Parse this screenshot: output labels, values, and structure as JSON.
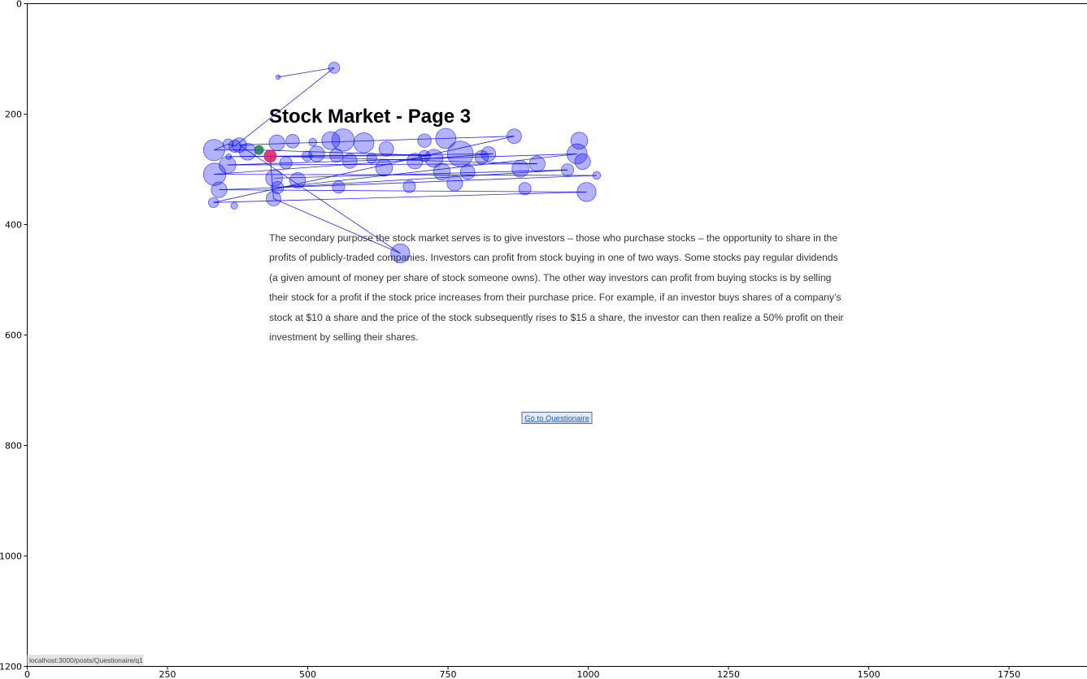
{
  "chart_data": {
    "type": "scatter",
    "title": "",
    "xlabel": "",
    "ylabel": "",
    "xlim": [
      0,
      1920
    ],
    "ylim": [
      1200,
      0
    ],
    "x_ticks": [
      0,
      250,
      500,
      750,
      1000,
      1250,
      1500,
      1750
    ],
    "y_ticks": [
      0,
      200,
      400,
      600,
      800,
      1000,
      1200
    ],
    "grid": false,
    "background_page": {
      "heading": "Stock Market - Page 3",
      "paragraph_lines": [
        "The secondary purpose the stock market serves is to give investors – those who purchase stocks – the opportunity to share in the",
        "profits of publicly-traded companies. Investors can profit from stock buying in one of two ways. Some stocks pay regular dividends",
        "(a given amount of money per share of stock someone owns). The other way investors can profit from buying stocks is by selling",
        "their stock for a profit if the stock price increases from their purchase price. For example, if an investor buys shares of a company’s",
        "stock at $10 a share and the price of the stock subsequently rises to $15 a share, the investor can then realize a 50% profit on their",
        "investment by selling their shares."
      ],
      "button_label": "Go to Questionaire",
      "status_url": "localhost:3000/posts/Questionaire/q1"
    },
    "series": [
      {
        "style": "fixations",
        "color": "#0000ff",
        "points": [
          {
            "x": 447,
            "y": 133,
            "d": 8
          },
          {
            "x": 547,
            "y": 116,
            "d": 20
          },
          {
            "x": 370,
            "y": 258,
            "d": 22
          },
          {
            "x": 358,
            "y": 254,
            "d": 18
          },
          {
            "x": 333,
            "y": 265,
            "d": 38
          },
          {
            "x": 393,
            "y": 268,
            "d": 30
          },
          {
            "x": 378,
            "y": 256,
            "d": 26
          },
          {
            "x": 359,
            "y": 277,
            "d": 10
          },
          {
            "x": 357,
            "y": 292,
            "d": 30
          },
          {
            "x": 334,
            "y": 309,
            "d": 40
          },
          {
            "x": 342,
            "y": 337,
            "d": 28
          },
          {
            "x": 332,
            "y": 360,
            "d": 18
          },
          {
            "x": 369,
            "y": 366,
            "d": 12
          },
          {
            "x": 439,
            "y": 353,
            "d": 26
          },
          {
            "x": 446,
            "y": 333,
            "d": 22
          },
          {
            "x": 440,
            "y": 316,
            "d": 30
          },
          {
            "x": 482,
            "y": 320,
            "d": 28
          },
          {
            "x": 461,
            "y": 288,
            "d": 22
          },
          {
            "x": 445,
            "y": 252,
            "d": 28
          },
          {
            "x": 473,
            "y": 249,
            "d": 24
          },
          {
            "x": 509,
            "y": 251,
            "d": 14
          },
          {
            "x": 516,
            "y": 272,
            "d": 28
          },
          {
            "x": 499,
            "y": 276,
            "d": 18
          },
          {
            "x": 541,
            "y": 248,
            "d": 32
          },
          {
            "x": 563,
            "y": 247,
            "d": 40
          },
          {
            "x": 551,
            "y": 275,
            "d": 24
          },
          {
            "x": 575,
            "y": 285,
            "d": 26
          },
          {
            "x": 600,
            "y": 252,
            "d": 36
          },
          {
            "x": 614,
            "y": 280,
            "d": 18
          },
          {
            "x": 640,
            "y": 263,
            "d": 26
          },
          {
            "x": 636,
            "y": 297,
            "d": 30
          },
          {
            "x": 681,
            "y": 331,
            "d": 22
          },
          {
            "x": 555,
            "y": 332,
            "d": 22
          },
          {
            "x": 691,
            "y": 285,
            "d": 28
          },
          {
            "x": 708,
            "y": 248,
            "d": 24
          },
          {
            "x": 708,
            "y": 276,
            "d": 20
          },
          {
            "x": 725,
            "y": 280,
            "d": 32
          },
          {
            "x": 739,
            "y": 304,
            "d": 30
          },
          {
            "x": 746,
            "y": 244,
            "d": 36
          },
          {
            "x": 772,
            "y": 272,
            "d": 46
          },
          {
            "x": 762,
            "y": 325,
            "d": 28
          },
          {
            "x": 785,
            "y": 305,
            "d": 26
          },
          {
            "x": 810,
            "y": 278,
            "d": 24
          },
          {
            "x": 822,
            "y": 272,
            "d": 26
          },
          {
            "x": 868,
            "y": 240,
            "d": 26
          },
          {
            "x": 879,
            "y": 299,
            "d": 30
          },
          {
            "x": 909,
            "y": 290,
            "d": 28
          },
          {
            "x": 887,
            "y": 335,
            "d": 22
          },
          {
            "x": 963,
            "y": 301,
            "d": 22
          },
          {
            "x": 984,
            "y": 248,
            "d": 30
          },
          {
            "x": 980,
            "y": 272,
            "d": 36
          },
          {
            "x": 990,
            "y": 286,
            "d": 28
          },
          {
            "x": 1015,
            "y": 311,
            "d": 14
          },
          {
            "x": 997,
            "y": 341,
            "d": 34
          },
          {
            "x": 665,
            "y": 452,
            "d": 34
          }
        ],
        "order": [
          1,
          0,
          2,
          3,
          4,
          5,
          6,
          7,
          8,
          9,
          10,
          11,
          12,
          13,
          14,
          15,
          16,
          17,
          18,
          19,
          20,
          21,
          22,
          23,
          24,
          25,
          26,
          27,
          28,
          29,
          30,
          31,
          32,
          33,
          34,
          35,
          36,
          37,
          38,
          39,
          40,
          41,
          42,
          43,
          44,
          45,
          46,
          47,
          48,
          49,
          50,
          51,
          52,
          53,
          54
        ]
      },
      {
        "style": "start-fixation",
        "color": "#1a7a4a",
        "points": [
          {
            "x": 413,
            "y": 265,
            "d": 16
          }
        ]
      },
      {
        "style": "end-fixation",
        "color": "#d81b60",
        "points": [
          {
            "x": 433,
            "y": 276,
            "d": 22
          }
        ]
      }
    ],
    "scanpath": [
      [
        447,
        133
      ],
      [
        547,
        116
      ],
      [
        370,
        258
      ],
      [
        358,
        254
      ],
      [
        333,
        265
      ],
      [
        413,
        265
      ],
      [
        720,
        275
      ],
      [
        359,
        277
      ],
      [
        830,
        272
      ],
      [
        333,
        309
      ],
      [
        1015,
        311
      ],
      [
        342,
        337
      ],
      [
        997,
        341
      ],
      [
        332,
        360
      ],
      [
        868,
        240
      ],
      [
        555,
        250
      ],
      [
        378,
        256
      ],
      [
        665,
        452
      ],
      [
        439,
        353
      ],
      [
        433,
        276
      ],
      [
        909,
        290
      ],
      [
        357,
        292
      ],
      [
        980,
        272
      ],
      [
        446,
        333
      ],
      [
        963,
        301
      ],
      [
        440,
        316
      ]
    ]
  },
  "accents": {
    "fixation_fill": "#0000ff",
    "start_fill": "#1a7a4a",
    "end_fill": "#d81b60",
    "button_bg": "#dfe9ff",
    "button_border": "#6a6a6a"
  }
}
